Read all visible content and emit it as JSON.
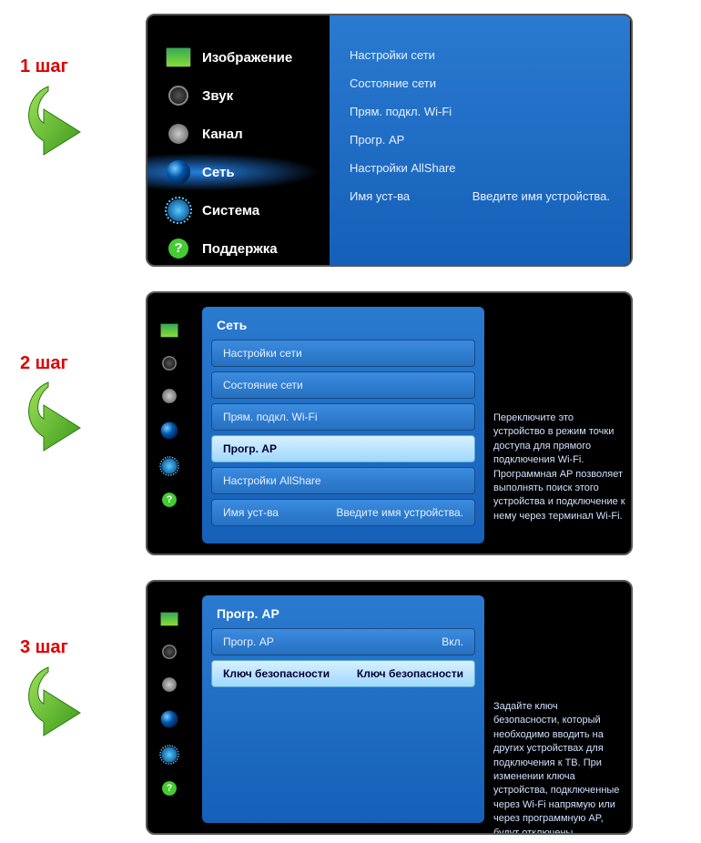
{
  "steps": {
    "s1": "1 шаг",
    "s2": "2 шаг",
    "s3": "3 шаг"
  },
  "step1": {
    "sidebar": [
      {
        "label": "Изображение"
      },
      {
        "label": "Звук"
      },
      {
        "label": "Канал"
      },
      {
        "label": "Сеть"
      },
      {
        "label": "Система"
      },
      {
        "label": "Поддержка"
      }
    ],
    "submenu": {
      "items": [
        "Настройки сети",
        "Состояние сети",
        "Прям. подкл. Wi-Fi",
        "Прогр. AP",
        "Настройки AllShare"
      ],
      "deviceName": {
        "label": "Имя уст-ва",
        "value": "Введите имя устройства."
      }
    }
  },
  "step2": {
    "title": "Сеть",
    "rows": [
      {
        "label": "Настройки сети"
      },
      {
        "label": "Состояние сети"
      },
      {
        "label": "Прям. подкл. Wi-Fi"
      },
      {
        "label": "Прогр. AP"
      },
      {
        "label": "Настройки AllShare"
      },
      {
        "label": "Имя уст-ва",
        "value": "Введите имя устройства."
      }
    ],
    "help": "Переключите это устройство в режим точки доступа для прямого подключения Wi-Fi. Программная AP позволяет выполнять поиск этого устройства и подключение к нему через терминал Wi-Fi."
  },
  "step3": {
    "title": "Прогр. AP",
    "rows": [
      {
        "label": "Прогр. AP",
        "value": "Вкл."
      },
      {
        "label": "Ключ безопасности",
        "value": "Ключ безопасности"
      }
    ],
    "help": "Задайте ключ безопасности, который необходимо вводить на других устройствах для подключения к ТВ. При изменении ключа устройства, подключенные через Wi-Fi напрямую или через программную AP, будут отключены."
  }
}
